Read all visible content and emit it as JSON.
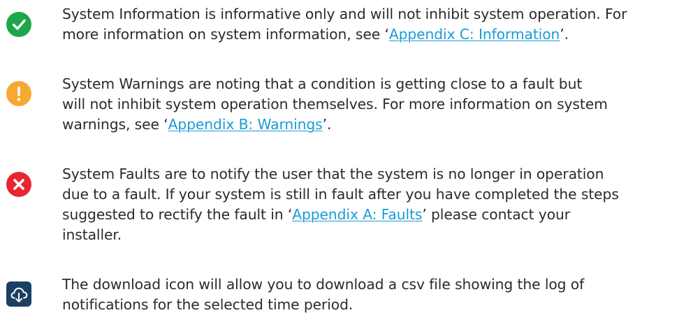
{
  "items": [
    {
      "icon": "check-circle-icon",
      "color": "#1ea64a",
      "before": [
        "System Information is informative only and will not inhibit system operation. For",
        "more information on system information, see ‘"
      ],
      "link": "Appendix C: Information",
      "after": "’."
    },
    {
      "icon": "warning-circle-icon",
      "color": "#f7a92f",
      "before": [
        "System Warnings are noting that a condition is getting close to a fault but",
        "will not inhibit system operation themselves. For more information on system",
        "warnings, see ‘"
      ],
      "link": "Appendix B: Warnings",
      "after": "’."
    },
    {
      "icon": "error-x-circle-icon",
      "color": "#e8262f",
      "before": [
        "System Faults are to notify the user that the system is no longer in operation",
        "due to a fault. If your system is still in fault after you have completed the steps",
        "suggested to rectify the fault in ‘"
      ],
      "link": "Appendix A: Faults",
      "after": "’ please contact your",
      "after_lines": [
        "installer."
      ]
    },
    {
      "icon": "cloud-download-icon",
      "color": "#1b3f63",
      "lines": [
        "The download icon will allow you to download a csv file showing the log of",
        "notifications for the selected time period."
      ]
    }
  ]
}
